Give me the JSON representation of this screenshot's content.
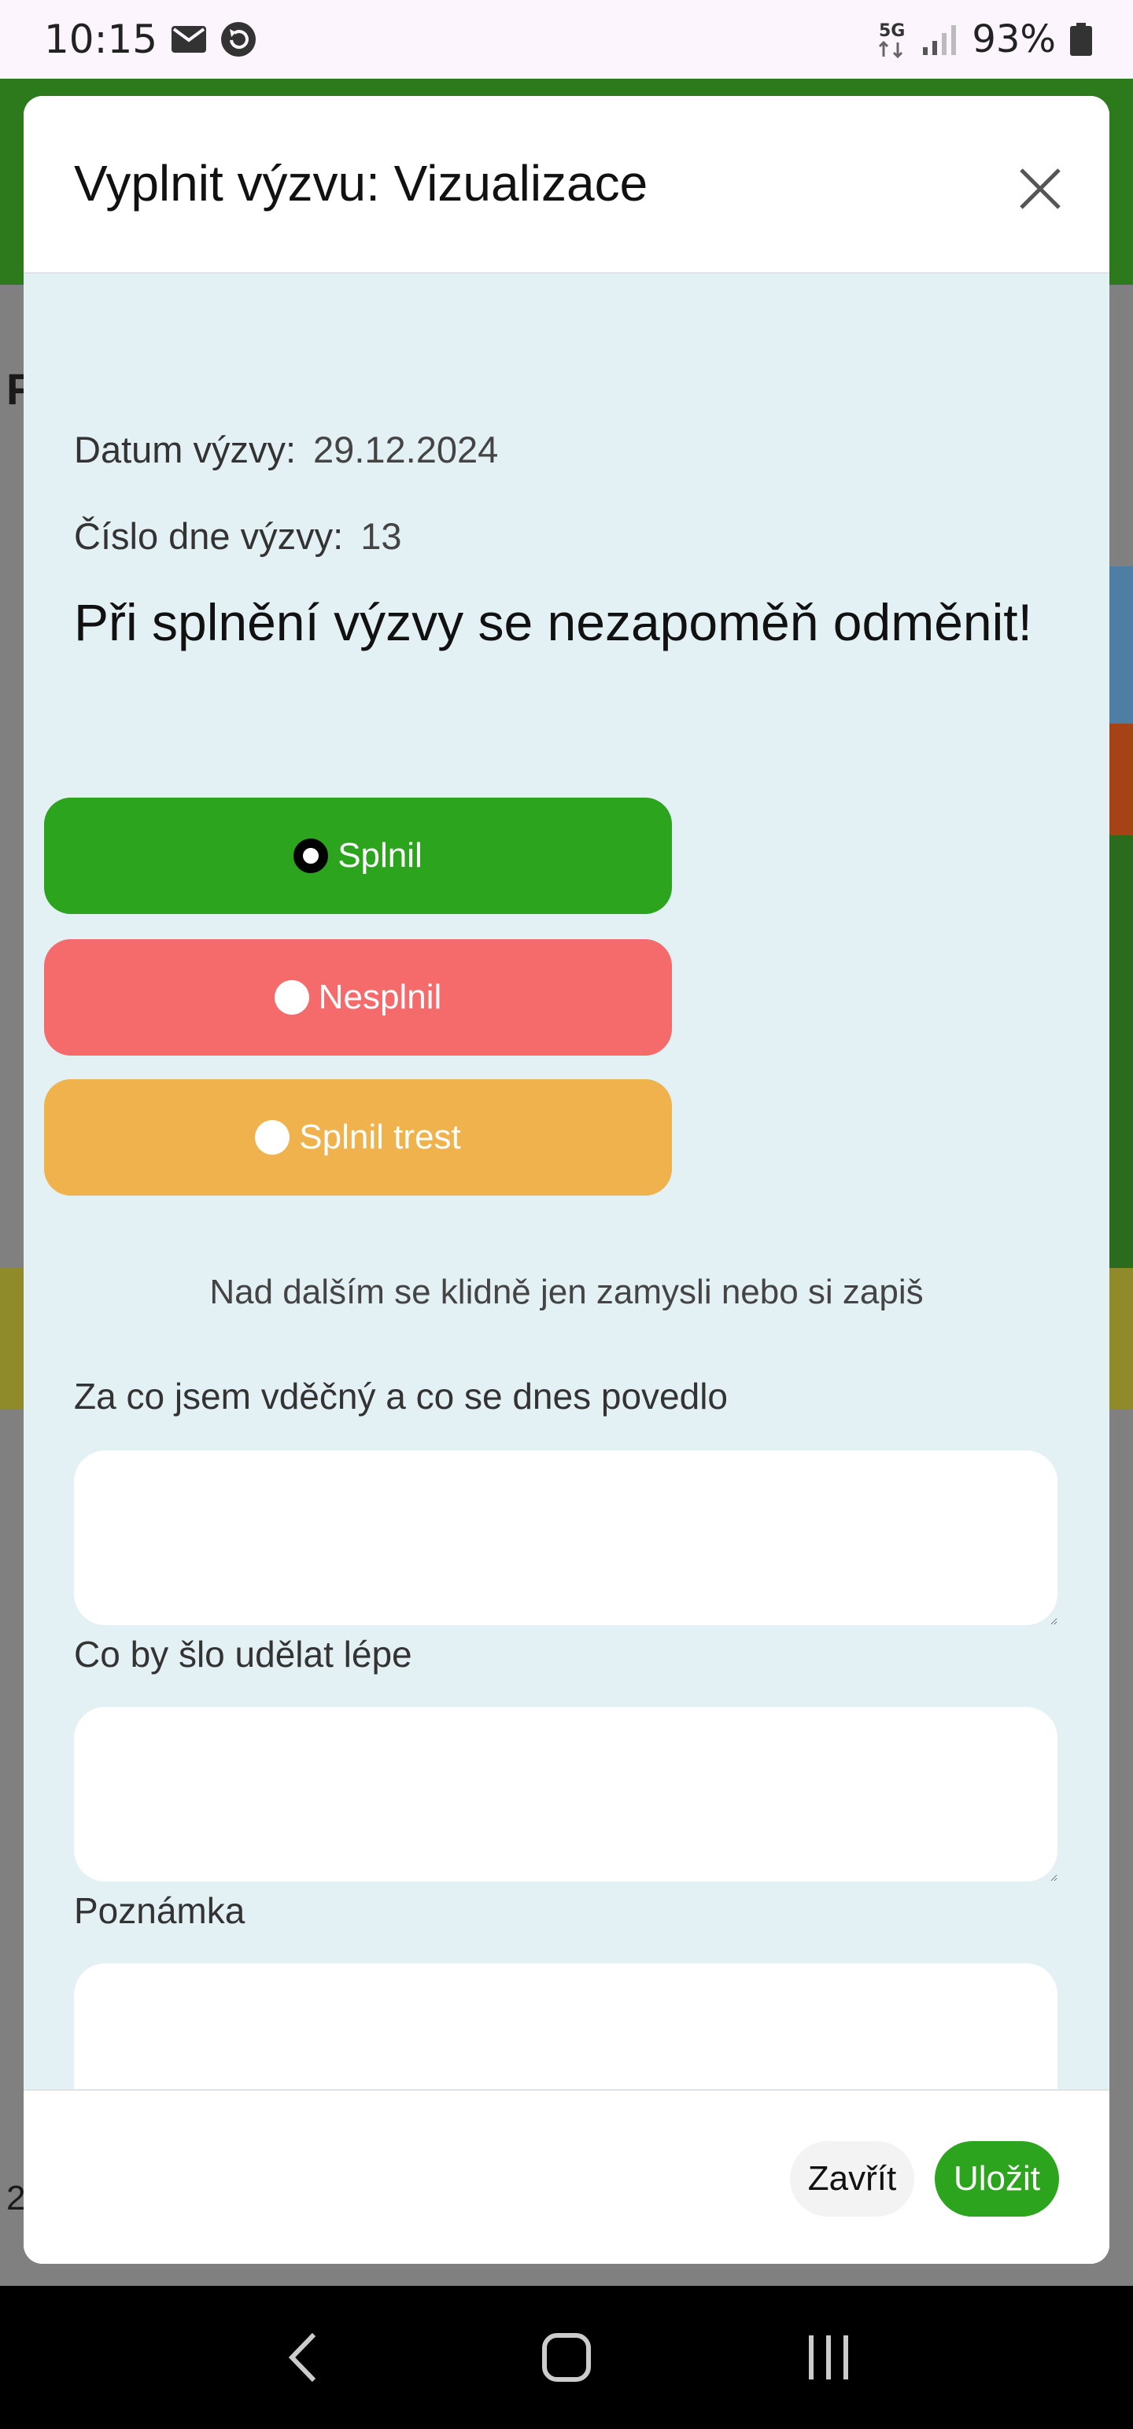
{
  "status_bar": {
    "time": "10:15",
    "icons": [
      "mail-icon",
      "sync-icon",
      "5g-icon",
      "signal-icon",
      "battery-icon"
    ],
    "network_label": "5G",
    "battery_percent": "93%"
  },
  "modal": {
    "title": "Vyplnit výzvu: Vizualizace",
    "date_label": "Datum výzvy:",
    "date_value": "29.12.2024",
    "day_label": "Číslo dne výzvy:",
    "day_value": "13",
    "reminder": "Při splnění výzvy se nezapoměň odměnit!",
    "options": [
      {
        "label": "Splnil",
        "color": "#2ca41e",
        "selected": true
      },
      {
        "label": "Nesplnil",
        "color": "#f56b6b",
        "selected": false
      },
      {
        "label": "Splnil trest",
        "color": "#f0b24c",
        "selected": false
      }
    ],
    "hint": "Nad dalším se klidně jen zamysli nebo si zapiš",
    "fields": [
      {
        "label": "Za co jsem vděčný a co se dnes povedlo",
        "value": ""
      },
      {
        "label": "Co by šlo udělat lépe",
        "value": ""
      },
      {
        "label": "Poznámka",
        "value": ""
      }
    ],
    "close_label": "Zavřít",
    "save_label": "Uložit"
  },
  "background": {
    "glyph_top": "F",
    "glyph_bottom": "2"
  },
  "colors": {
    "accent_green": "#2ca41e",
    "modal_body_bg": "#e4f1f4"
  }
}
